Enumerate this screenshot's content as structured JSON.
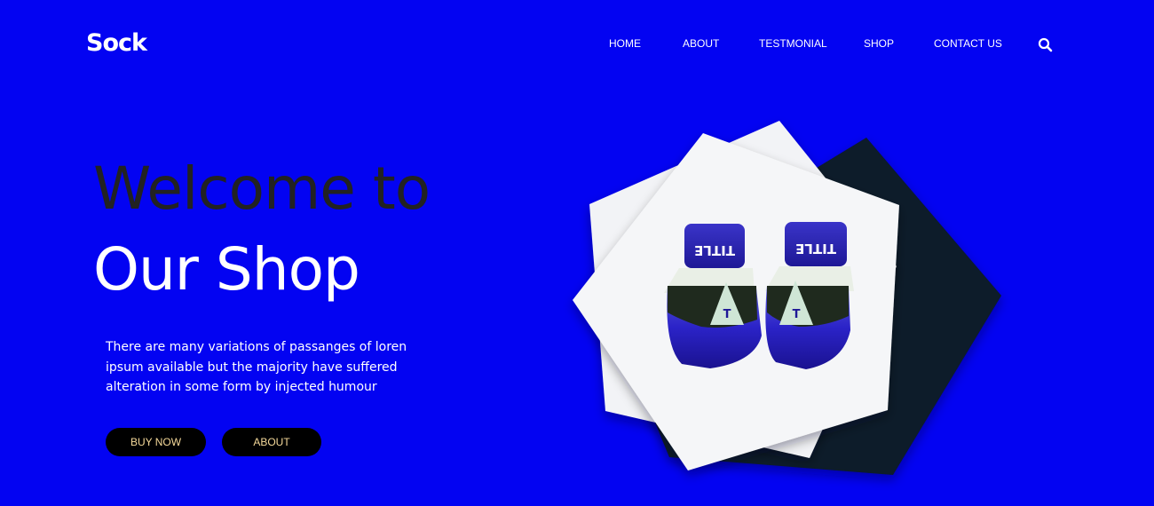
{
  "brand": {
    "name": "Sock"
  },
  "nav": {
    "items": [
      "HOME",
      "ABOUT",
      "TESTMONIAL",
      "SHOP",
      "CONTACT US"
    ]
  },
  "search": {
    "icon": "search-icon"
  },
  "hero": {
    "title_line1": "Welcome to",
    "title_line2": "Our Shop",
    "description": "There are many variations of passanges of loren ipsum available but the majority have suffered alteration in some form by injected humour",
    "buy_label": "BUY NOW",
    "about_label": "ABOUT"
  },
  "product": {
    "image": "boxing-gloves-image",
    "glove_text": "TITLE"
  },
  "colors": {
    "background": "#0303f2",
    "title_dark": "#222222",
    "button_bg": "#000000",
    "button_text": "#f5d99a",
    "card_white": "#f4f5f7",
    "card_dark": "#0a1a2a"
  }
}
